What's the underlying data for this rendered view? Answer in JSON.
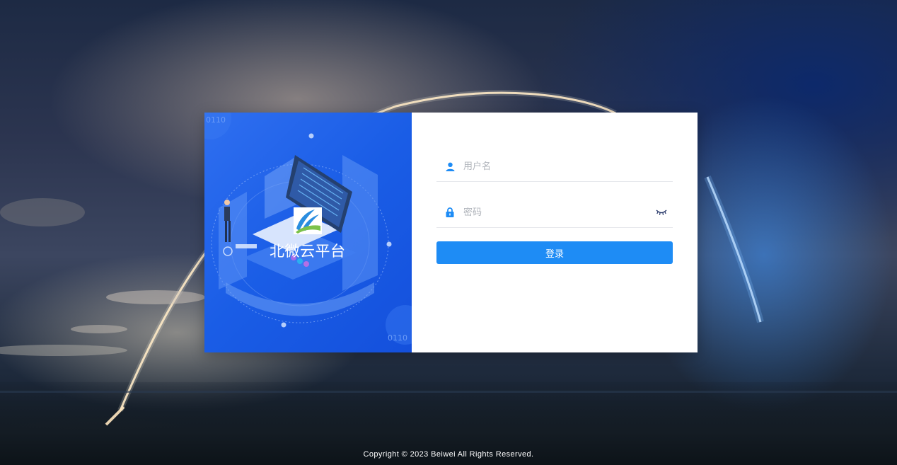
{
  "brand": {
    "name": "北微云平台",
    "binary_text_top": "0110",
    "binary_text_bottom": "0110"
  },
  "login_form": {
    "username_placeholder": "用户名",
    "password_placeholder": "密码",
    "submit_label": "登录"
  },
  "footer": {
    "copyright": "Copyright © 2023 Beiwei All Rights Reserved."
  },
  "colors": {
    "primary_button": "#1e8cf5",
    "left_panel": "#1a5de6",
    "icon_blue": "#1e8cf5"
  },
  "icons": {
    "username": "user-icon",
    "password": "lock-icon",
    "toggle_password": "eye-closed-icon"
  }
}
